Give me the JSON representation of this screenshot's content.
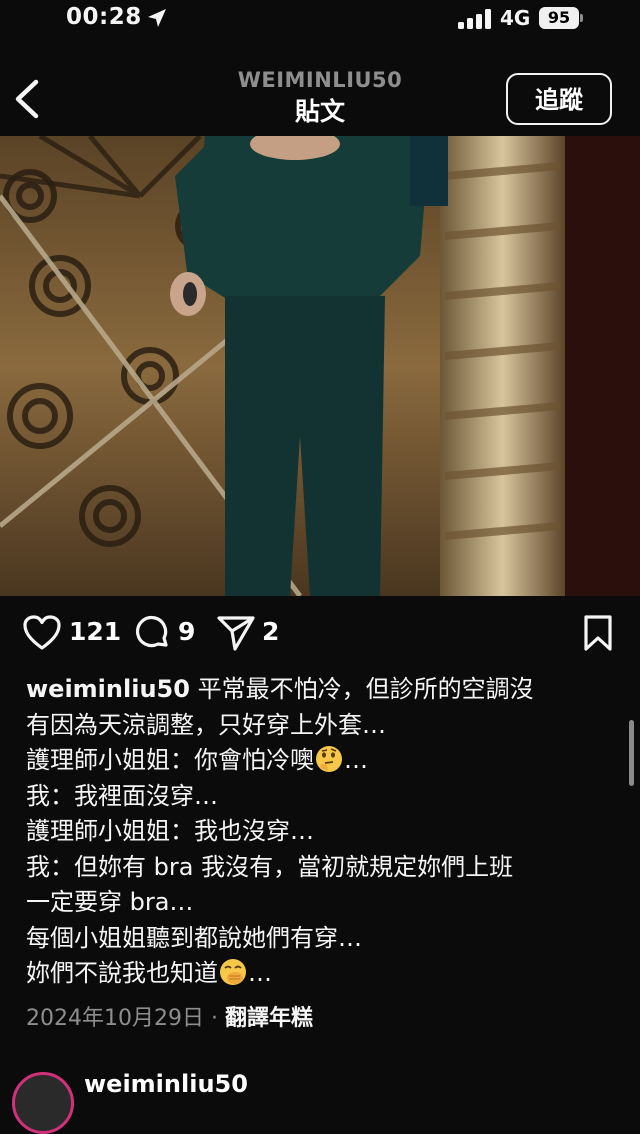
{
  "status_bar": {
    "time": "00:28",
    "network": "4G",
    "battery": "95",
    "icons": [
      "location-arrow-icon",
      "signal-bars-icon"
    ]
  },
  "header": {
    "username": "WEIMINLIU50",
    "title": "貼文",
    "follow_label": "追蹤",
    "back_icon": "chevron-left-icon"
  },
  "media": {
    "mute_icon": "muted-speaker-icon"
  },
  "actions": {
    "likes": "121",
    "comments": "9",
    "shares": "2",
    "icons": [
      "heart-icon",
      "comment-icon",
      "send-icon",
      "bookmark-icon"
    ]
  },
  "caption": {
    "username": "weiminliu50",
    "line1": "平常最不怕冷，但診所的空調沒",
    "line2": "有因為天涼調整，只好穿上外套…",
    "line3": "護理師小姐姐：你會怕冷噢",
    "line3_end": "…",
    "line4": "我：我裡面沒穿…",
    "line5": "護理師小姐姐：我也沒穿…",
    "line6": "我：但妳有 bra 我沒有，當初就規定妳們上班",
    "line7": "一定要穿 bra…",
    "line8": "每個小姐姐聽到都說她們有穿…",
    "line9": "妳們不說我也知道",
    "line9_end": "…",
    "emojis": [
      "thinking-face-icon",
      "hand-over-mouth-face-icon"
    ]
  },
  "meta": {
    "date": "2024年10月29日",
    "separator": "·",
    "translate": "翻譯年糕"
  },
  "next_post": {
    "username": "weiminliu50"
  },
  "colors": {
    "background": "#0b0b0b",
    "secondary_text": "#8e8e8e",
    "story_ring": "#d2317a"
  }
}
